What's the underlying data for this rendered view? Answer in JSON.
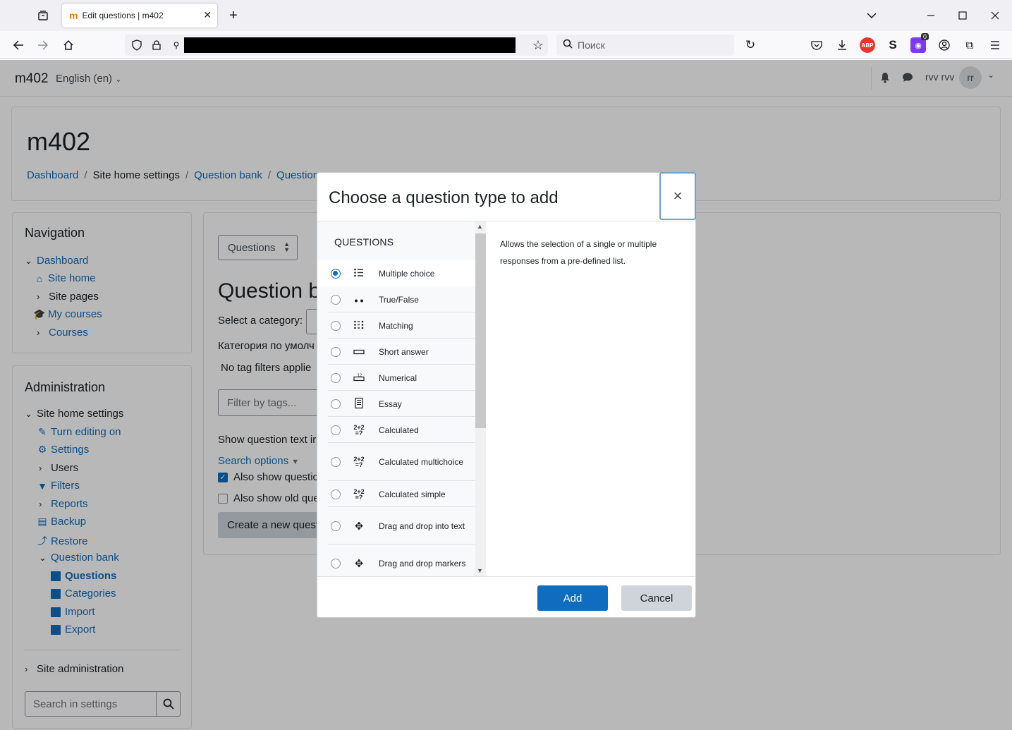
{
  "browser": {
    "tab_title": "Edit questions | m402",
    "search_placeholder": "Поиск",
    "extension_badge": "0"
  },
  "moodle": {
    "site_name": "m402",
    "language": "English (en)",
    "user_name": "rvv rvv",
    "user_initials": "rr",
    "page_heading": "m402",
    "breadcrumbs": [
      "Dashboard",
      "Site home settings",
      "Question bank",
      "Question"
    ]
  },
  "navigation": {
    "title": "Navigation",
    "items": [
      "Dashboard",
      "Site home",
      "Site pages",
      "My courses",
      "Courses"
    ]
  },
  "administration": {
    "title": "Administration",
    "section": "Site home settings",
    "items": [
      "Turn editing on",
      "Settings",
      "Users",
      "Filters",
      "Reports",
      "Backup",
      "Restore",
      "Question bank"
    ],
    "qbank_items": [
      "Questions",
      "Categories",
      "Import",
      "Export"
    ],
    "site_admin": "Site administration",
    "search_placeholder": "Search in settings"
  },
  "main": {
    "questions_select": "Questions",
    "heading": "Question b",
    "select_category": "Select a category:",
    "default_category": "Категория по умолч",
    "no_tag_filters": "No tag filters applie",
    "filter_placeholder": "Filter by tags...",
    "show_question_text": "Show question text ir",
    "search_options": "Search options",
    "also_show_1": "Also show questic",
    "also_show_2": "Also show old que",
    "create_button": "Create a new quest"
  },
  "modal": {
    "title": "Choose a question type to add",
    "list_header": "QUESTIONS",
    "selected_description": "Allows the selection of a single or multiple responses from a pre-defined list.",
    "add_label": "Add",
    "cancel_label": "Cancel",
    "question_types": [
      {
        "label": "Multiple choice",
        "icon": "list-icon",
        "selected": true
      },
      {
        "label": "True/False",
        "icon": "two-dots-icon",
        "selected": false
      },
      {
        "label": "Matching",
        "icon": "matching-icon",
        "selected": false
      },
      {
        "label": "Short answer",
        "icon": "short-answer-icon",
        "selected": false
      },
      {
        "label": "Numerical",
        "icon": "numerical-icon",
        "selected": false
      },
      {
        "label": "Essay",
        "icon": "essay-icon",
        "selected": false
      },
      {
        "label": "Calculated",
        "icon": "calculated-icon",
        "selected": false
      },
      {
        "label": "Calculated multichoice",
        "icon": "calculated-multichoice-icon",
        "selected": false
      },
      {
        "label": "Calculated simple",
        "icon": "calculated-simple-icon",
        "selected": false
      },
      {
        "label": "Drag and drop into text",
        "icon": "drag-drop-text-icon",
        "selected": false
      },
      {
        "label": "Drag and drop markers",
        "icon": "drag-drop-markers-icon",
        "selected": false
      }
    ]
  },
  "colors": {
    "primary": "#0f6cbf",
    "secondary_button": "#ced4da",
    "brand_orange": "#f98012"
  }
}
